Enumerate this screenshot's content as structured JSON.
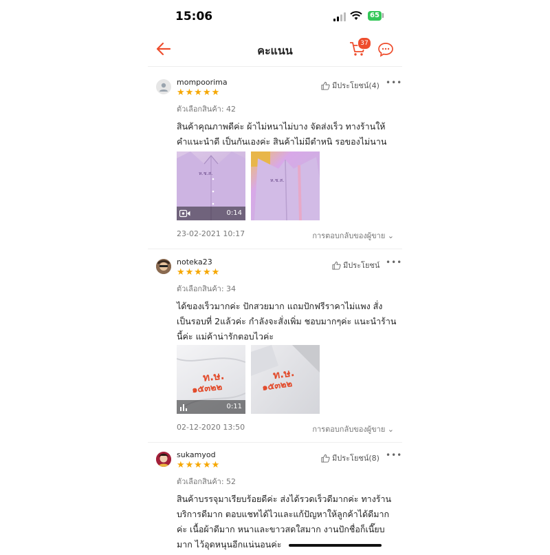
{
  "status_bar": {
    "time": "15:06",
    "battery": "65"
  },
  "header": {
    "title": "คะแนน",
    "cart_count": "37"
  },
  "reviews": [
    {
      "username": "mompoorima",
      "stars": "★★★★★",
      "helpful": "มีประโยชน์(4)",
      "variant": "ตัวเลือกสินค้า: 42",
      "lines": [
        "สินค้าคุณภาพดีค่ะ ผ้าไม่หนาไม่บาง  จัดส่งเร็ว ทางร้านให้",
        "คำแนะนำดี เป็นกันเองค่ะ สินค้าไม่มีตำหนิ รอของไม่นานค่ะ"
      ],
      "video_duration": "0:14",
      "date": "23-02-2021 10:17",
      "seller_reply": "การตอบกลับของผู้ขาย"
    },
    {
      "username": "noteka23",
      "stars": "★★★★★",
      "helpful": "มีประโยชน์",
      "variant": "ตัวเลือกสินค้า: 34",
      "lines": [
        "ได้ของเร็วมากค่ะ ปักสวยมาก แถมปักฟรีราคาไม่แพง สั่ง",
        "เป็นรอบที่ 2แล้วค่ะ กำลังจะสั่งเพิ่ม ชอบมากๆค่ะ แนะนำร้าน",
        "นี้ค่ะ แม่ค้าน่ารักตอบไวค่ะ"
      ],
      "embroidery": [
        "ท.ษ.",
        "๑๕๓๒๒"
      ],
      "video_duration": "0:11",
      "date": "02-12-2020 13:50",
      "seller_reply": "การตอบกลับของผู้ขาย"
    },
    {
      "username": "sukamyod",
      "stars": "★★★★★",
      "helpful": "มีประโยชน์(8)",
      "variant": "ตัวเลือกสินค้า: 52",
      "lines": [
        "สินค้าบรรจุมาเรียบร้อยดีค่ะ ส่งได้รวดเร็วดีมากค่ะ ทางร้าน",
        "บริการดีมาก ตอบแชทได้ไวและแก้ปัญหาให้ลูกค้าได้ดีมาก",
        "ค่ะ เนื้อผ้าดีมาก หนาและขาวสดใสมาก งานปักชื่อก็เนี๊ยบ",
        "มาก ไว้อุดหนุนอีกแน่นอนค่ะ"
      ]
    }
  ],
  "colors": {
    "accent": "#ee4d2d",
    "star": "#f6a700",
    "battery": "#34c759"
  }
}
